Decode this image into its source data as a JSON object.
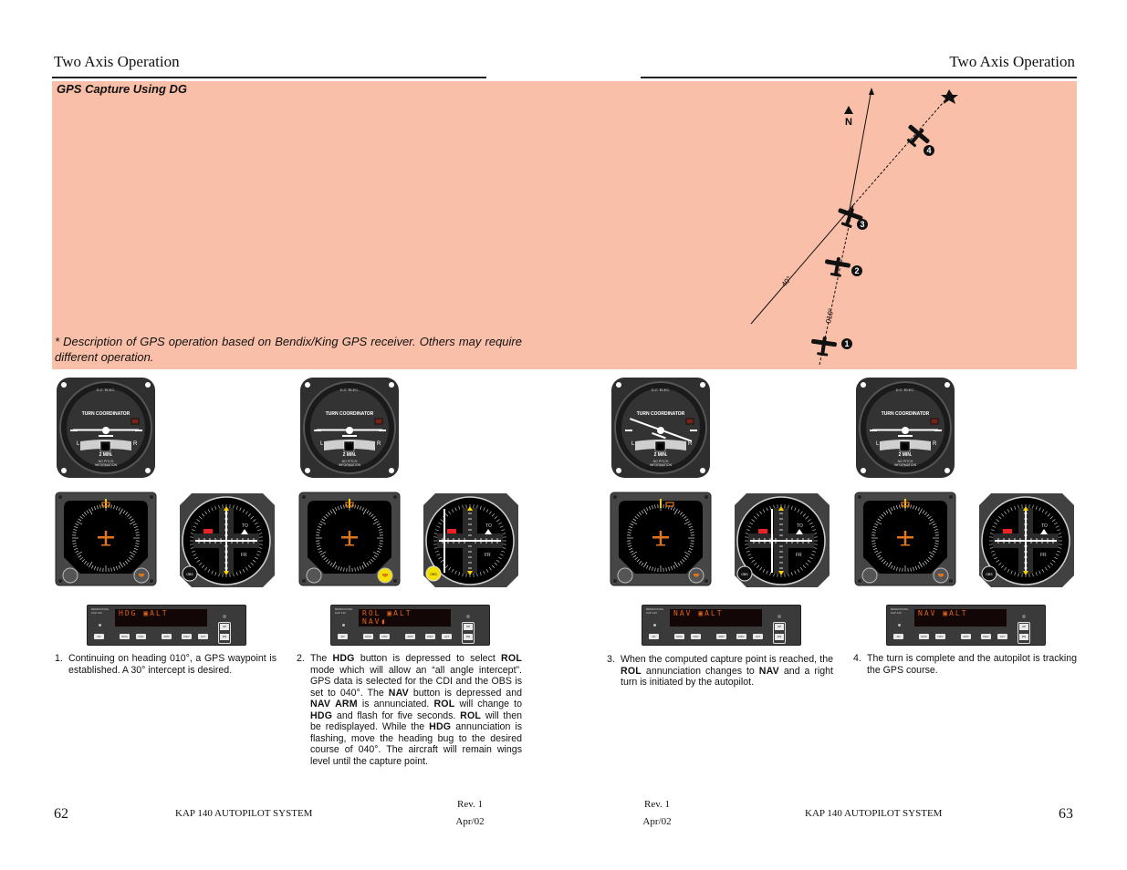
{
  "left_page": {
    "header_title": "Two Axis Operation",
    "page_number": "62",
    "footer_title": "KAP 140 AUTOPILOT SYSTEM",
    "rev": "Rev. 1",
    "date": "Apr/02"
  },
  "right_page": {
    "header_title": "Two Axis Operation",
    "page_number": "63",
    "footer_title": "KAP 140 AUTOPILOT SYSTEM",
    "rev": "Rev. 1",
    "date": "Apr/02"
  },
  "band": {
    "title": "GPS Capture Using DG",
    "note": "* Description of GPS operation based on Bendix/King GPS receiver. Others may require different operation.",
    "color": "#f9bfa8"
  },
  "diagram": {
    "north_label": "N",
    "intercept_label": "40°",
    "heading_label": "010°",
    "markers": [
      "1",
      "2",
      "3",
      "4"
    ]
  },
  "turn_coordinator": {
    "top_label": "D.C. ELEC.",
    "title": "TURN COORDINATOR",
    "left": "L",
    "right": "R",
    "time": "2 MIN.",
    "bottom_line1": "NO PITCH",
    "bottom_line2": "INFORMATION"
  },
  "cdi": {
    "to_label": "TO",
    "fr_label": "FR",
    "obs_label": "OBS",
    "flag_label": "NAV"
  },
  "autopilot": {
    "brand_line1": "BENDIX/KING",
    "brand_line2": "KAP 140",
    "buttons": [
      "AP",
      "HDG",
      "NAV",
      "APR",
      "REV",
      "ALT"
    ],
    "up": "UP",
    "dn": "DN",
    "accent": "#e0661c"
  },
  "steps": [
    {
      "number": "1.",
      "display_line1": "HDG ▣ALT",
      "display_line2": "",
      "text": "Continuing on heading 010°, a GPS waypoint is established. A 30° intercept is desired."
    },
    {
      "number": "2.",
      "display_line1": "ROL ▣ALT",
      "display_line2": "NAV▮",
      "parts": [
        {
          "t": "The "
        },
        {
          "b": "HDG"
        },
        {
          "t": " button is depressed to select "
        },
        {
          "b": "ROL"
        },
        {
          "t": " mode which will allow an “all angle intercept”. GPS data is selected for the CDI and the OBS is set to 040°. The "
        },
        {
          "b": "NAV"
        },
        {
          "t": " button is depressed and "
        },
        {
          "b": "NAV ARM"
        },
        {
          "t": " is annunciated. "
        },
        {
          "b": "ROL"
        },
        {
          "t": " will change to "
        },
        {
          "b": "HDG"
        },
        {
          "t": " and flash for five seconds. "
        },
        {
          "b": "ROL"
        },
        {
          "t": " will then be redisplayed. While the "
        },
        {
          "b": "HDG"
        },
        {
          "t": " annunciation is flashing, move the heading bug to the desired course of 040°. The aircraft will remain wings level until the capture point."
        }
      ]
    },
    {
      "number": "3.",
      "display_line1": "NAV ▣ALT",
      "display_line2": "",
      "parts": [
        {
          "t": "When the computed capture point is reached, the "
        },
        {
          "b": "ROL"
        },
        {
          "t": " annunciation changes to "
        },
        {
          "b": "NAV"
        },
        {
          "t": " and a right turn is initiated by the autopilot."
        }
      ]
    },
    {
      "number": "4.",
      "display_line1": "NAV ▣ALT",
      "display_line2": "",
      "text": "The turn is complete and the autopilot is tracking the GPS course."
    }
  ]
}
